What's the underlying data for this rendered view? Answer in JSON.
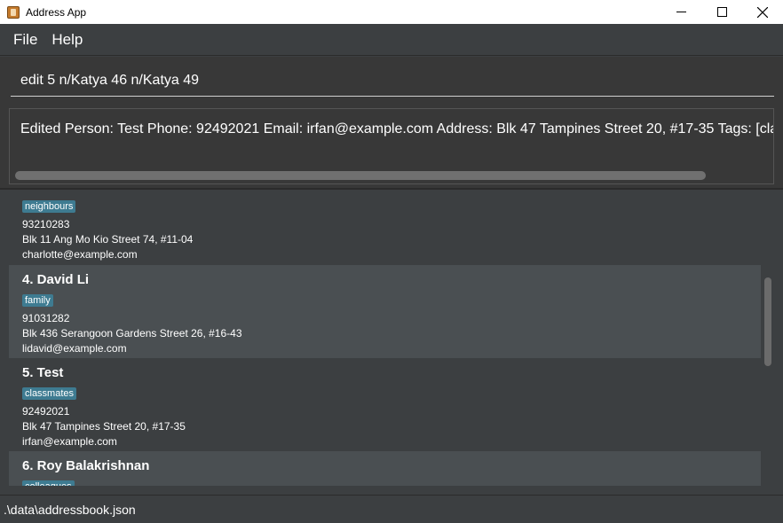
{
  "window": {
    "title": "Address App"
  },
  "menu": {
    "file": "File",
    "help": "Help"
  },
  "command": {
    "value": "edit 5 n/Katya 46 n/Katya 49"
  },
  "result": {
    "text": "Edited Person: Test Phone: 92492021 Email: irfan@example.com Address: Blk 47 Tampines Street 20, #17-35 Tags: [classmates]"
  },
  "persons": [
    {
      "tag": "neighbours",
      "phone": "93210283",
      "address": "Blk 11 Ang Mo Kio Street 74, #11-04",
      "email": "charlotte@example.com"
    },
    {
      "name": "4.  David Li",
      "tag": "family",
      "phone": "91031282",
      "address": "Blk 436 Serangoon Gardens Street 26, #16-43",
      "email": "lidavid@example.com"
    },
    {
      "name": "5.  Test",
      "tag": "classmates",
      "phone": "92492021",
      "address": "Blk 47 Tampines Street 20, #17-35",
      "email": "irfan@example.com"
    },
    {
      "name": "6.  Roy Balakrishnan",
      "tag": "colleagues"
    }
  ],
  "status": {
    "path": ".\\data\\addressbook.json"
  },
  "colors": {
    "tag_bg": "#3e7b91",
    "background": "#3c3f41",
    "card_alt": "#4a4f52"
  }
}
